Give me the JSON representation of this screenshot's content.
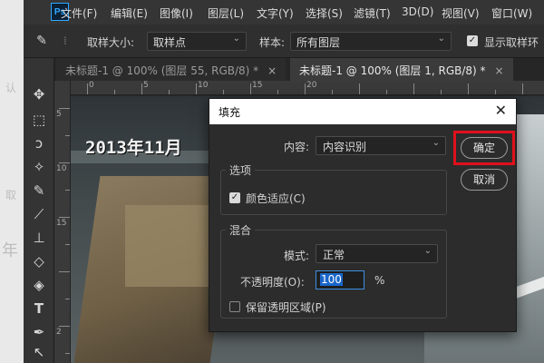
{
  "outer": {
    "fragments": [
      "认",
      "取",
      "年"
    ]
  },
  "menubar": {
    "logo": "Ps",
    "items": [
      "文件(F)",
      "编辑(E)",
      "图像(I)",
      "图层(L)",
      "文字(Y)",
      "选择(S)",
      "滤镜(T)",
      "3D(D)",
      "视图(V)",
      "窗口(W)"
    ]
  },
  "options": {
    "sample_size_label": "取样大小:",
    "sample_size_value": "取样点",
    "sample_label": "样本:",
    "sample_value": "所有图层",
    "show_ring_label": "显示取样环"
  },
  "tabs": [
    {
      "label": "未标题-1 @ 100% (图层 55, RGB/8) *",
      "close": "×"
    },
    {
      "label": "未标题-1 @ 100% (图层 1, RGB/8) *",
      "close": "×"
    }
  ],
  "ruler": {
    "top_numbers": [
      "0",
      "5",
      "10",
      "15",
      "20"
    ],
    "left_numbers": [
      "5",
      "10",
      "15",
      "2"
    ]
  },
  "canvas": {
    "stamp": "2013年11月"
  },
  "dialog": {
    "title": "填充",
    "close": "✕",
    "content_label": "内容:",
    "content_value": "内容识别",
    "options_title": "选项",
    "color_adapt_label": "颜色适应(C)",
    "color_adapt_checked": true,
    "blend_title": "混合",
    "mode_label": "模式:",
    "mode_value": "正常",
    "opacity_label": "不透明度(O):",
    "opacity_value": "100",
    "opacity_unit": "%",
    "preserve_label": "保留透明区域(P)",
    "preserve_checked": false,
    "ok_label": "确定",
    "cancel_label": "取消"
  },
  "colors": {
    "highlight": "#e0101b",
    "ps_blue": "#31a8ff"
  }
}
